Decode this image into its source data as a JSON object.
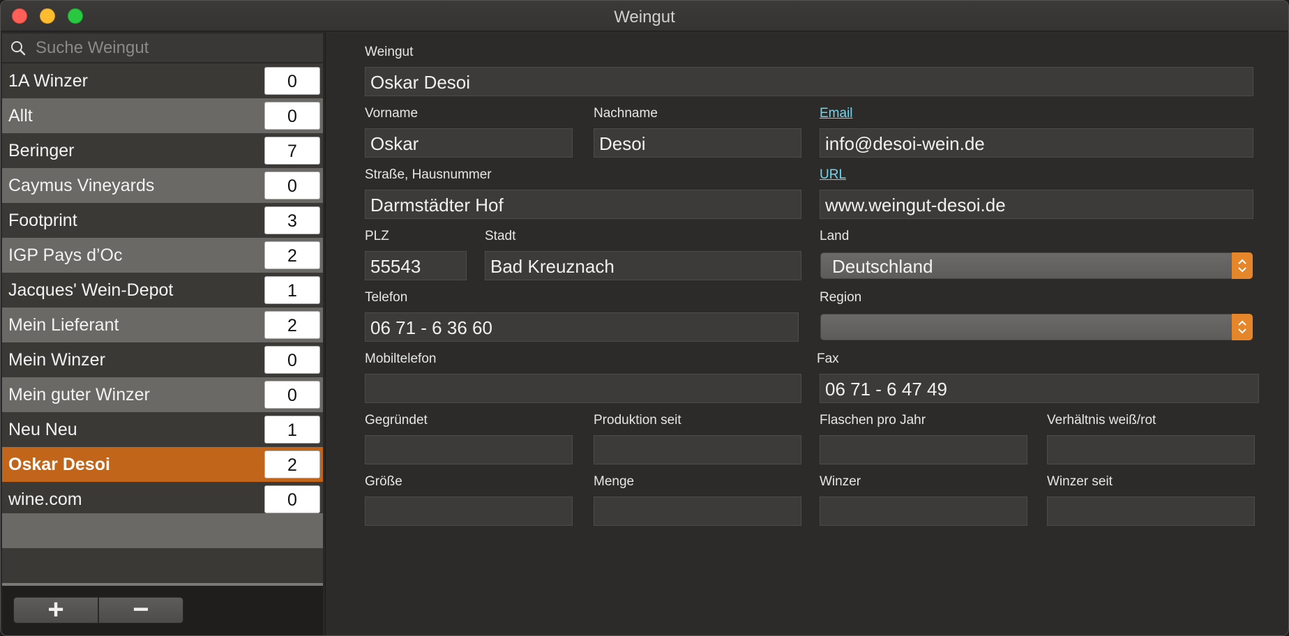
{
  "window": {
    "title": "Weingut"
  },
  "search": {
    "placeholder": "Suche Weingut"
  },
  "list": {
    "items": [
      {
        "label": "1A Winzer",
        "count": "0"
      },
      {
        "label": "Allt",
        "count": "0"
      },
      {
        "label": "Beringer",
        "count": "7"
      },
      {
        "label": "Caymus Vineyards",
        "count": "0"
      },
      {
        "label": "Footprint",
        "count": "3"
      },
      {
        "label": "IGP Pays d’Oc",
        "count": "2"
      },
      {
        "label": "Jacques' Wein-Depot",
        "count": "1"
      },
      {
        "label": "Mein Lieferant",
        "count": "2"
      },
      {
        "label": "Mein Winzer",
        "count": "0"
      },
      {
        "label": "Mein guter Winzer",
        "count": "0"
      },
      {
        "label": "Neu Neu",
        "count": "1"
      },
      {
        "label": "Oskar Desoi",
        "count": "2"
      },
      {
        "label": "wine.com",
        "count": "0"
      }
    ],
    "selected_index": 11
  },
  "footer": {
    "add_label": "+",
    "remove_label": "−"
  },
  "form": {
    "weingut": {
      "label": "Weingut",
      "value": "Oskar Desoi"
    },
    "vorname": {
      "label": "Vorname",
      "value": "Oskar"
    },
    "nachname": {
      "label": "Nachname",
      "value": "Desoi"
    },
    "email": {
      "label": "Email",
      "value": "info@desoi-wein.de"
    },
    "strasse": {
      "label": "Straße, Hausnummer",
      "value": "Darmstädter Hof"
    },
    "url": {
      "label": "URL",
      "value": "www.weingut-desoi.de"
    },
    "plz": {
      "label": "PLZ",
      "value": "55543"
    },
    "stadt": {
      "label": "Stadt",
      "value": "Bad Kreuznach"
    },
    "land": {
      "label": "Land",
      "value": "Deutschland"
    },
    "telefon": {
      "label": "Telefon",
      "value": "06 71 - 6 36 60"
    },
    "region": {
      "label": "Region",
      "value": ""
    },
    "mobiltelefon": {
      "label": "Mobiltelefon",
      "value": ""
    },
    "fax": {
      "label": "Fax",
      "value": "06 71 - 6 47 49"
    },
    "gegruendet": {
      "label": "Gegründet",
      "value": ""
    },
    "produktion_seit": {
      "label": "Produktion seit",
      "value": ""
    },
    "flaschen_pro_jahr": {
      "label": "Flaschen pro Jahr",
      "value": ""
    },
    "verhaeltnis": {
      "label": "Verhältnis weiß/rot",
      "value": ""
    },
    "groesse": {
      "label": "Größe",
      "value": ""
    },
    "menge": {
      "label": "Menge",
      "value": ""
    },
    "winzer": {
      "label": "Winzer",
      "value": ""
    },
    "winzer_seit": {
      "label": "Winzer seit",
      "value": ""
    }
  },
  "colors": {
    "accent": "#c0651a",
    "popup_arrow": "#e5862a",
    "link": "#6fd8f0"
  }
}
